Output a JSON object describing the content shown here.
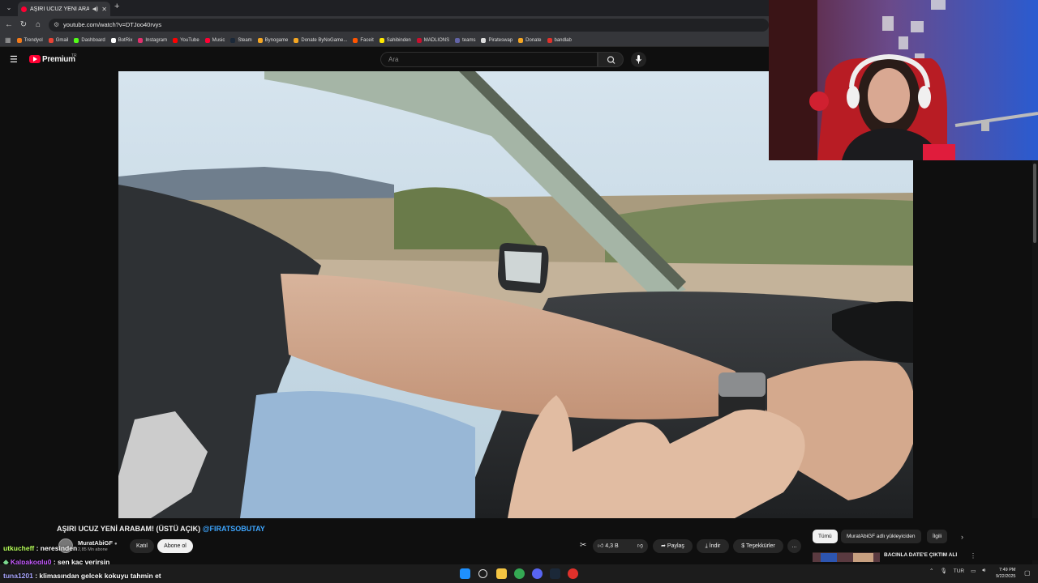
{
  "browser": {
    "tab_title": "AŞIRI UCUZ YENİ ARABAM!",
    "url": "youtube.com/watch?v=DTJoo40rvys",
    "bookmarks": [
      "Trendyol",
      "Gmail",
      "Dashboard",
      "BotRix",
      "Instagram",
      "YouTube",
      "Music",
      "Steam",
      "Bynogame",
      "Donate ByNoGame...",
      "Faceit",
      "Sahibinden",
      "MADLIONS",
      "teams",
      "Pirateswap",
      "Donate",
      "bandlab"
    ],
    "bookmark_colors": [
      "#f27a1a",
      "#ea4335",
      "#53fc18",
      "#ffffff",
      "#e1306c",
      "#ff0000",
      "#ff0033",
      "#1b2838",
      "#f5a623",
      "#f5a623",
      "#ff5500",
      "#ffe800",
      "#c8102e",
      "#6264a7",
      "#dddddd",
      "#f5a623",
      "#e0312b"
    ]
  },
  "youtube": {
    "brand": "Premium",
    "country": "TR",
    "search_placeholder": "Ara"
  },
  "video": {
    "title": "AŞIRI UCUZ YENİ ARABAM! (ÜSTÜ AÇIK)",
    "title_tag": "@FIRATSOBUTAY",
    "channel": "MuratAbiGF",
    "subscribers": "2,85 Mn abone",
    "join_label": "Katıl",
    "subscribe_label": "Abone ol",
    "likes": "4,3 B",
    "share_label": "Paylaş",
    "download_label": "İndir",
    "thanks_label": "Teşekkürler",
    "more_label": "..."
  },
  "sidebar": {
    "chips": [
      "Tümü",
      "MuratAbiGF adlı yükleyiciden",
      "İlgili"
    ],
    "rec_title": "BACINLA DATE'E ÇIKTIM ALİ"
  },
  "chat": [
    {
      "user": "utkucheff",
      "msg": " : neresinden"
    },
    {
      "user": "Kalpakoglu0",
      "msg": " : sen kaç verirsin"
    },
    {
      "user": "tuna1201",
      "msg": " : klimasından gelcek kokuyu tahmin et"
    }
  ],
  "taskbar": {
    "lang": "TUR",
    "time": "7:49 PM",
    "date": "9/22/2025"
  }
}
